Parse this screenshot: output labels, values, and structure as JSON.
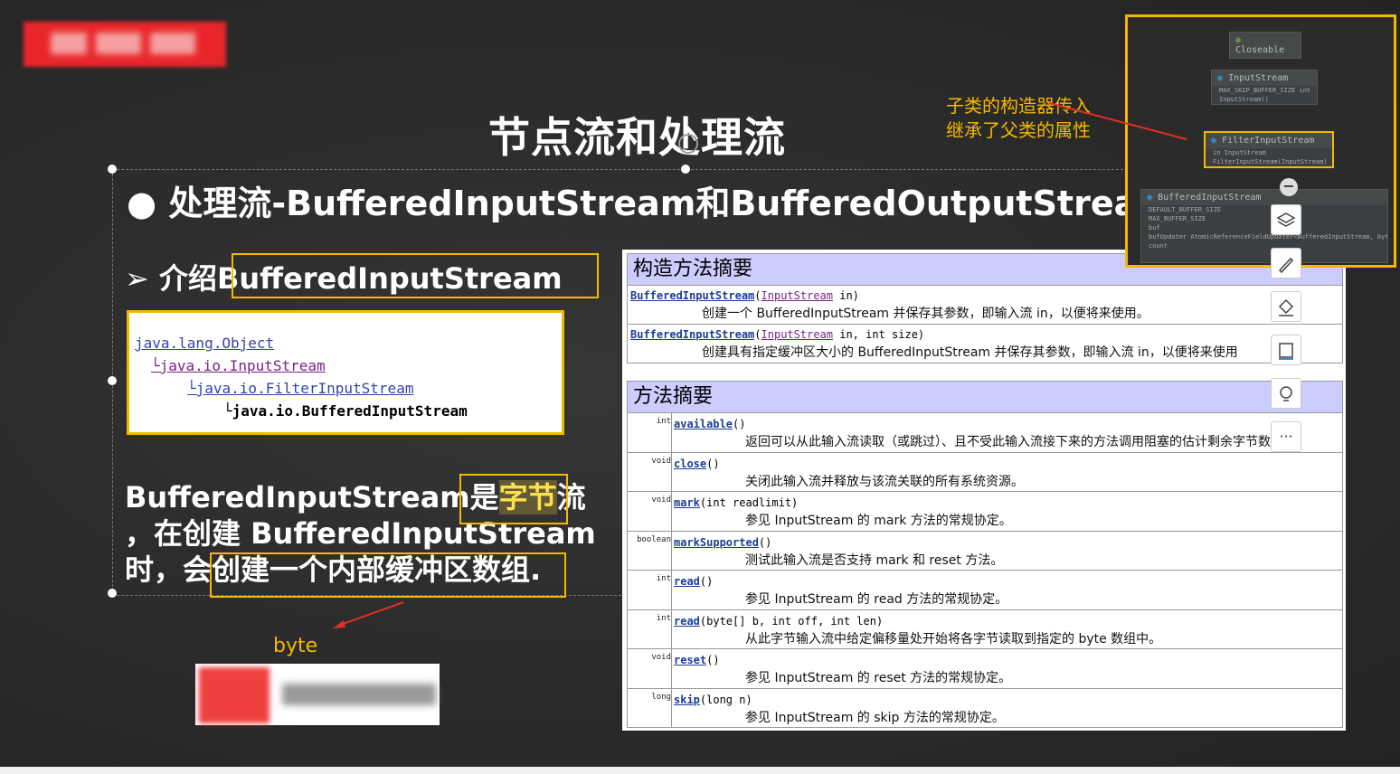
{
  "slide": {
    "title": "节点流和处理流",
    "bullet": "● 处理流-BufferedInputStream和BufferedOutputStream",
    "intro_prefix": "➢  介绍",
    "intro_class": "BufferedInputStream",
    "hierarchy": [
      "java.lang.Object",
      "└java.io.InputStream",
      "└java.io.FilterInputStream",
      "└java.io.BufferedInputStream"
    ],
    "para_line1_a": "BufferedInputStream是",
    "para_line1_hl": "字节",
    "para_line1_b": "流",
    "para_line2": "，在创建 BufferedInputStream",
    "para_line3_a": "时，会",
    "para_line3_b": "创建一个内部缓冲区数组.",
    "byte_label": "byte",
    "annotation_line1": "子类的构造器传入",
    "annotation_line2": "继承了父类的属性"
  },
  "doc": {
    "constructors_title": "构造方法摘要",
    "constructors": [
      {
        "name": "BufferedInputStream",
        "param_type": "InputStream",
        "rest": " in)",
        "desc": "创建一个 BufferedInputStream 并保存其参数，即输入流 in，以便将来使用。"
      },
      {
        "name": "BufferedInputStream",
        "param_type": "InputStream",
        "rest": " in, int size)",
        "desc": "创建具有指定缓冲区大小的 BufferedInputStream 并保存其参数，即输入流 in，以便将来使用"
      }
    ],
    "methods_title": "方法摘要",
    "methods": [
      {
        "type": "int",
        "name": "available",
        "params": "()",
        "desc": "返回可以从此输入流读取（或跳过）、且不受此输入流接下来的方法调用阻塞的估计剩余字节数。"
      },
      {
        "type": "void",
        "name": "close",
        "params": "()",
        "desc": "关闭此输入流并释放与该流关联的所有系统资源。"
      },
      {
        "type": "void",
        "name": "mark",
        "params": "(int readlimit)",
        "desc": "参见 InputStream 的 mark 方法的常规协定。"
      },
      {
        "type": "boolean",
        "name": "markSupported",
        "params": "()",
        "desc": "测试此输入流是否支持 mark 和 reset 方法。"
      },
      {
        "type": "int",
        "name": "read",
        "params": "()",
        "desc": "参见 InputStream 的 read 方法的常规协定。"
      },
      {
        "type": "int",
        "name": "read",
        "params": "(byte[] b, int off, int len)",
        "desc": "从此字节输入流中给定偏移量处开始将各字节读取到指定的 byte 数组中。"
      },
      {
        "type": "void",
        "name": "reset",
        "params": "()",
        "desc": "参见 InputStream 的 reset 方法的常规协定。"
      },
      {
        "type": "long",
        "name": "skip",
        "params": "(long n)",
        "desc": "参见 InputStream 的 skip 方法的常规协定。"
      }
    ]
  },
  "uml": {
    "closeable": "Closeable",
    "inputstream": {
      "title": "InputStream",
      "items": [
        "MAX_SKIP_BUFFER_SIZE int",
        "InputStream()"
      ]
    },
    "filter": {
      "title": "FilterInputStream",
      "items": [
        "in                  InputStream",
        "FilterInputStream(InputStream)"
      ]
    },
    "buffered": {
      "title": "BufferedInputStream",
      "items": [
        "DEFAULT_BUFFER_SIZE",
        "MAX_BUFFER_SIZE",
        "buf",
        "bufUpdater  AtomicReferenceFieldUpdater<BufferedInputStream, byte[]>",
        "count"
      ]
    }
  },
  "toolbar": {
    "more_label": "···"
  },
  "colors": {
    "accent": "#f5b800",
    "slide_bg": "#2b2b2b",
    "doc_header": "#ccccff"
  }
}
